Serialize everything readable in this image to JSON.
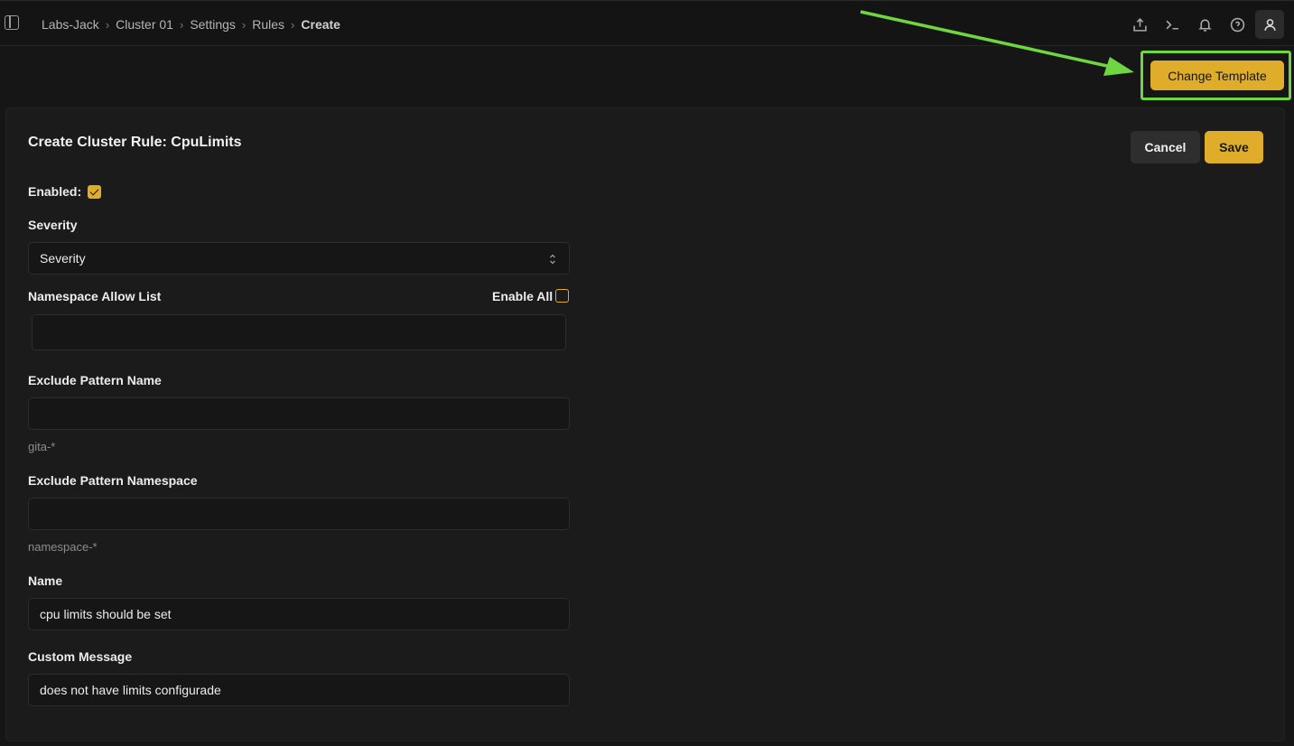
{
  "breadcrumb": [
    "Labs-Jack",
    "Cluster 01",
    "Settings",
    "Rules",
    "Create"
  ],
  "top_icons": [
    "upload-icon",
    "terminal-icon",
    "bell-icon",
    "help-icon",
    "user-icon"
  ],
  "change_template_label": "Change Template",
  "form": {
    "title": "Create Cluster Rule: CpuLimits",
    "cancel_label": "Cancel",
    "save_label": "Save",
    "enabled_label": "Enabled:",
    "enabled": true,
    "severity_label": "Severity",
    "severity_value": "Severity",
    "namespace_allow_label": "Namespace Allow List",
    "enable_all_label": "Enable All",
    "enable_all": false,
    "namespace_allow_value": "",
    "exclude_name_label": "Exclude Pattern Name",
    "exclude_name_value": "",
    "exclude_name_hint": "gita-*",
    "exclude_ns_label": "Exclude Pattern Namespace",
    "exclude_ns_value": "",
    "exclude_ns_hint": "namespace-*",
    "name_label": "Name",
    "name_value": "cpu limits should be set",
    "custom_message_label": "Custom Message",
    "custom_message_value": "does not have limits configurade"
  },
  "colors": {
    "accent": "#e0ad2b",
    "highlight": "#6fd540",
    "background": "#161616",
    "card": "#1b1b1b"
  }
}
